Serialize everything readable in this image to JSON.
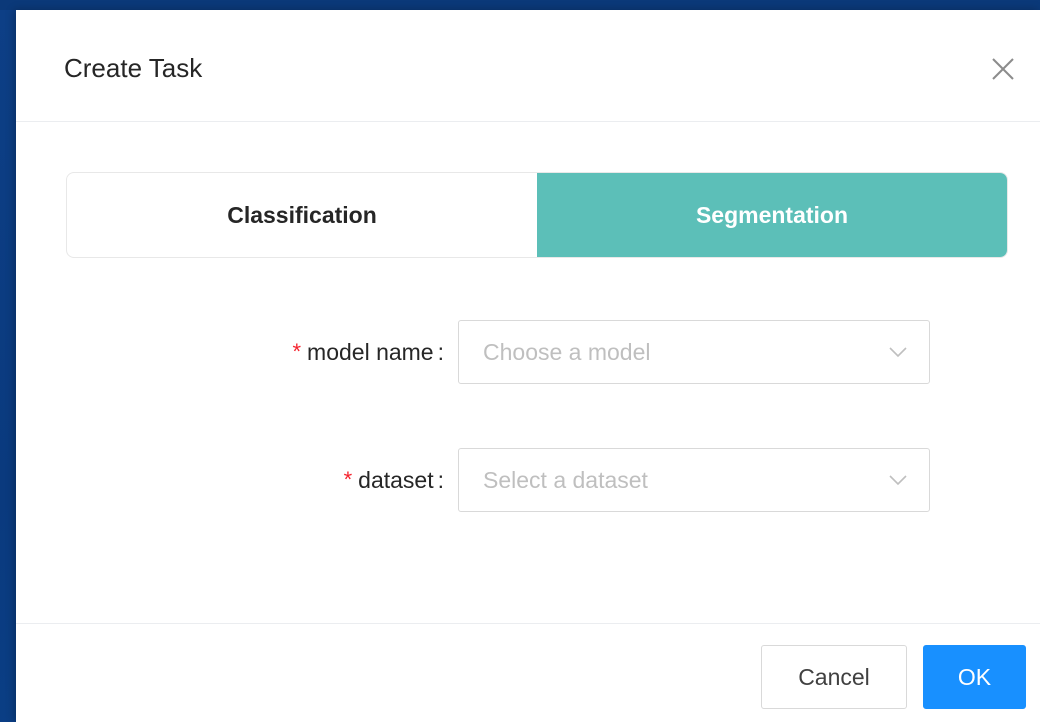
{
  "modal": {
    "title": "Create Task"
  },
  "task_type": {
    "options": [
      {
        "label": "Classification",
        "active": false
      },
      {
        "label": "Segmentation",
        "active": true
      }
    ],
    "active_color": "#5cbfb8"
  },
  "form": {
    "model_name": {
      "required_mark": "*",
      "label": "model name",
      "colon": ":",
      "placeholder": "Choose a model"
    },
    "dataset": {
      "required_mark": "*",
      "label": "dataset",
      "colon": ":",
      "placeholder": "Select a dataset"
    }
  },
  "footer": {
    "cancel_label": "Cancel",
    "ok_label": "OK",
    "primary_color": "#1890ff"
  },
  "icons": {
    "close": "close-icon",
    "dropdown": "chevron-down-icon"
  }
}
